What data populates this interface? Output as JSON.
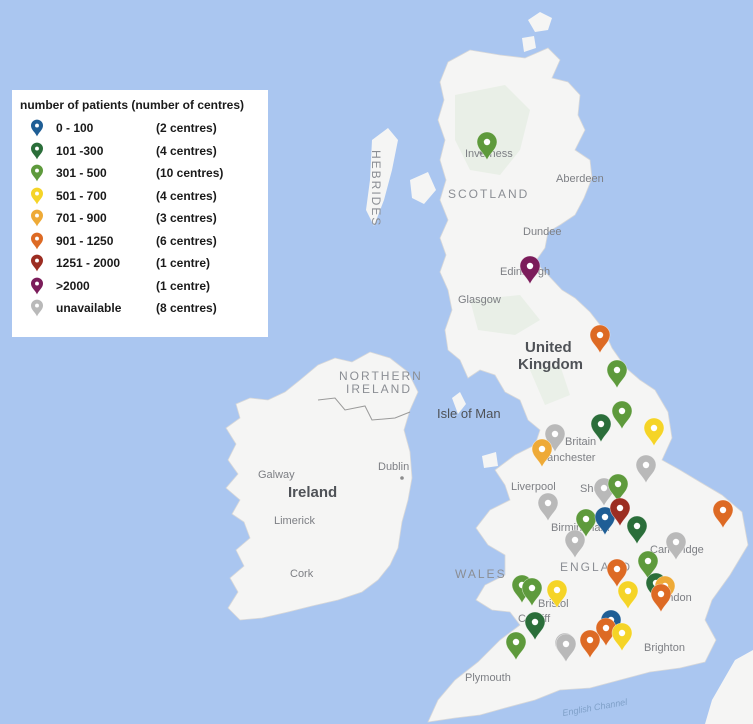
{
  "legend": {
    "title": "number of patients (number of centres)",
    "items": [
      {
        "key": "a",
        "range": "0 - 100",
        "count": "(2 centres)",
        "color": "#1f5e95"
      },
      {
        "key": "b",
        "range": "101 -300",
        "count": "(4 centres)",
        "color": "#2b6e3a"
      },
      {
        "key": "c",
        "range": "301 - 500",
        "count": "(10 centres)",
        "color": "#5e9a3c"
      },
      {
        "key": "d",
        "range": "501 - 700",
        "count": "(4 centres)",
        "color": "#f5d427"
      },
      {
        "key": "e",
        "range": "701 - 900",
        "count": "(3 centres)",
        "color": "#eeaa37"
      },
      {
        "key": "f",
        "range": "901 - 1250",
        "count": "(6 centres)",
        "color": "#dd6a24"
      },
      {
        "key": "g",
        "range": "1251 - 2000",
        "count": "(1 centre)",
        "color": "#9c2d22"
      },
      {
        "key": "h",
        "range": ">2000",
        "count": "(1 centre)",
        "color": "#7b1c5a"
      },
      {
        "key": "i",
        "range": "unavailable",
        "count": "(8 centres)",
        "color": "#b9b9b9"
      }
    ]
  },
  "map_labels": {
    "scotland": "SCOTLAND",
    "hebrides": "HEBRIDES",
    "northern_ireland_1": "NORTHERN",
    "northern_ireland_2": "IRELAND",
    "wales": "WALES",
    "england": "ENGLAND",
    "united_kingdom_1": "United",
    "united_kingdom_2": "Kingdom",
    "ireland": "Ireland",
    "isle_of_man": "Isle of Man",
    "english_channel": "English Channel",
    "inverness": "Inverness",
    "aberdeen": "Aberdeen",
    "dundee": "Dundee",
    "edinburgh": "Edinburgh",
    "glasgow": "Glasgow",
    "britain": "Britain",
    "manchester": "Manchester",
    "liverpool": "Liverpool",
    "sheffield": "Sheffield",
    "birmingham": "Birmingham",
    "cambridge": "Cambridge",
    "bristol": "Bristol",
    "cardiff": "Cardiff",
    "london": "London",
    "brighton": "Brighton",
    "plymouth": "Plymouth",
    "dublin": "Dublin",
    "galway": "Galway",
    "limerick": "Limerick",
    "cork": "Cork"
  },
  "markers": [
    {
      "category": "c"
    },
    {
      "category": "h"
    },
    {
      "category": "f"
    },
    {
      "category": "c"
    },
    {
      "category": "c"
    },
    {
      "category": "b"
    },
    {
      "category": "d"
    },
    {
      "category": "i"
    },
    {
      "category": "e"
    },
    {
      "category": "i"
    },
    {
      "category": "i"
    },
    {
      "category": "c"
    },
    {
      "category": "i"
    },
    {
      "category": "i"
    },
    {
      "category": "c"
    },
    {
      "category": "a"
    },
    {
      "category": "g"
    },
    {
      "category": "b"
    },
    {
      "category": "f"
    },
    {
      "category": "i"
    },
    {
      "category": "i"
    },
    {
      "category": "c"
    },
    {
      "category": "f"
    },
    {
      "category": "b"
    },
    {
      "category": "e"
    },
    {
      "category": "f"
    },
    {
      "category": "d"
    },
    {
      "category": "c"
    },
    {
      "category": "c"
    },
    {
      "category": "d"
    },
    {
      "category": "b"
    },
    {
      "category": "a"
    },
    {
      "category": "f"
    },
    {
      "category": "f"
    },
    {
      "category": "d"
    },
    {
      "category": "c"
    },
    {
      "category": "i"
    }
  ]
}
